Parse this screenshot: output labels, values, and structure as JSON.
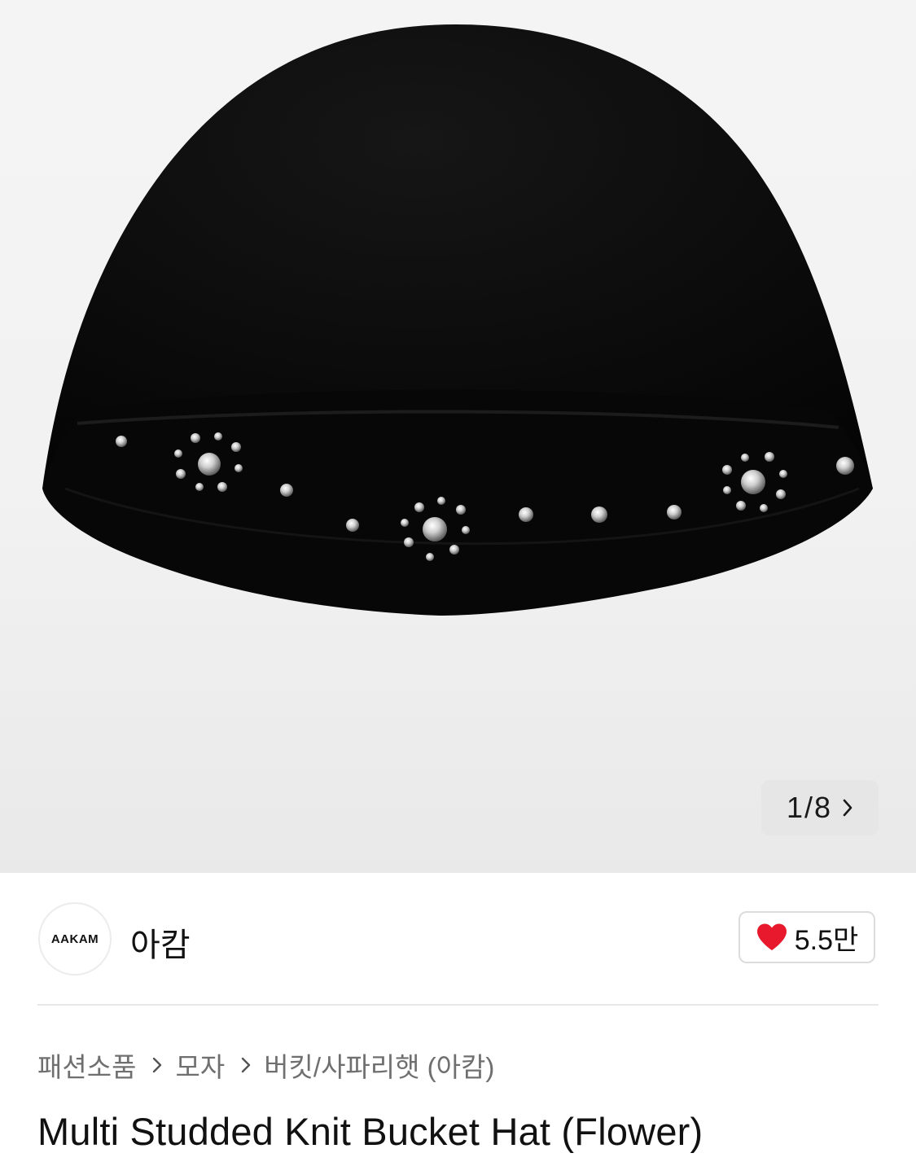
{
  "gallery": {
    "image_alt": "product-photo-black-knit-bucket-hat-with-studs",
    "counter": {
      "current": "1",
      "separator": "/",
      "total": "8",
      "next_icon": "chevron-right-icon"
    }
  },
  "brand": {
    "logo_text": "AAKAM",
    "name": "아캄"
  },
  "like": {
    "icon": "heart-icon",
    "count": "5.5만",
    "color": "#e8192c"
  },
  "breadcrumb": {
    "items": [
      "패션소품",
      "모자",
      "버킷/사파리햇 (아캄)"
    ],
    "separator_icon": "chevron-right-icon"
  },
  "product": {
    "title": "Multi Studded Knit Bucket Hat (Flower)"
  }
}
